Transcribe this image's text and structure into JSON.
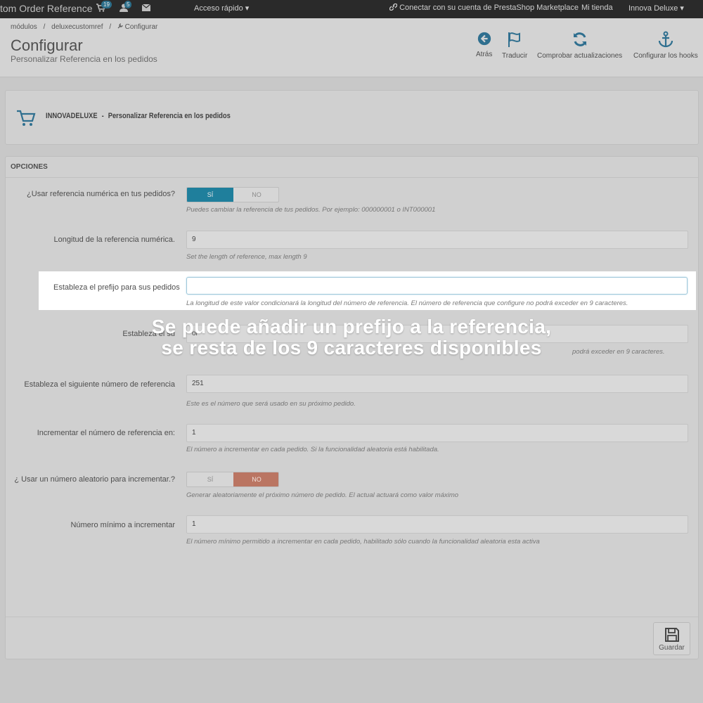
{
  "topbar": {
    "brand": "tom Order Reference",
    "cart_badge": "19",
    "user_badge": "5",
    "quick_access": "Acceso rápido ▾",
    "marketplace": "Conectar con su cuenta de PrestaShop Marketplace",
    "my_shop": "Mi tienda",
    "account": "Innova Deluxe ▾"
  },
  "breadcrumb": [
    "módulos",
    "deluxecustomref",
    "Configurar"
  ],
  "header": {
    "title": "Configurar",
    "subtitle": "Personalizar Referencia en los pedidos"
  },
  "toolbar": [
    {
      "label": "Atrás",
      "icon": "back-circle-icon"
    },
    {
      "label": "Traducir",
      "icon": "flag-icon"
    },
    {
      "label": "Comprobar actualizaciones",
      "icon": "refresh-icon"
    },
    {
      "label": "Configurar los hooks",
      "icon": "anchor-icon"
    }
  ],
  "module": {
    "brand": "INNOVADELUXE",
    "separator": "-",
    "name": "Personalizar Referencia en los pedidos"
  },
  "options": {
    "heading": "OPCIONES",
    "use_numeric": {
      "label": "¿Usar referencia numérica en tus pedidos?",
      "yes": "SÍ",
      "no": "NO",
      "help": "Puedes cambiar la referencia de tus pedidos. Por ejemplo: 000000001 o INT000001"
    },
    "length": {
      "label": "Longitud de la referencia numérica.",
      "value": "9",
      "help": "Set the length of reference, max length 9"
    },
    "prefix": {
      "label": "Estableza el prefijo para sus pedidos",
      "value": "",
      "help": "La longitud de este valor condicionará la longitud del número de referencia. El número de referencia que configure no podrá exceder en 9 caracteres."
    },
    "suffix": {
      "label_visible": "Estableza el su",
      "value_visible": "or",
      "help_visible": "podrá exceder en 9 caracteres."
    },
    "next_number": {
      "label": "Estableza el siguiente número de referencia",
      "value": "251",
      "help": "Este es el número que será usado en su próximo pedido."
    },
    "increment": {
      "label": "Incrementar el número de referencia en:",
      "value": "1",
      "help": "El número a incrementar en cada pedido. Si la funcionalidad aleatoria está habilitada."
    },
    "random": {
      "label": "¿ Usar un número aleatorio para incrementar.?",
      "yes": "SÍ",
      "no": "NO",
      "help": "Generar aleatoriamente el próximo número de pedido. El actual actuará como valor máximo"
    },
    "min_increment": {
      "label": "Número mínimo a incrementar",
      "value": "1",
      "help": "El número mínimo permitido a incrementar en cada pedido, habilitado sólo cuando la funcionalidad aleatoria esta activa"
    }
  },
  "save_label": "Guardar",
  "overlay": {
    "line1": "Se puede añadir un prefijo a la referencia,",
    "line2": "se resta de los 9 caracteres disponibles"
  }
}
